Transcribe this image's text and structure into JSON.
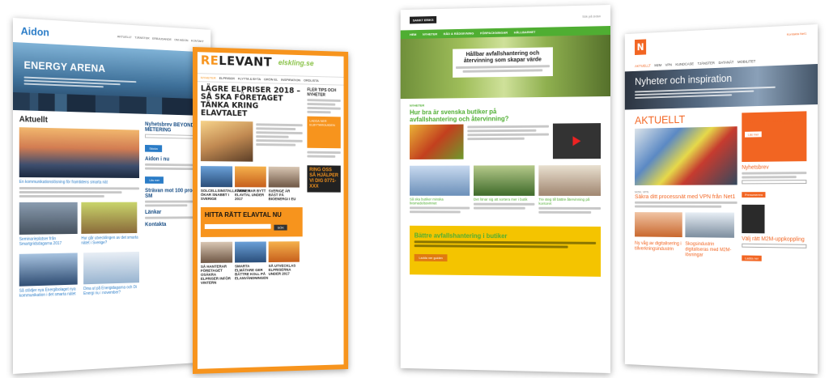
{
  "aidon": {
    "logo": "Aidon",
    "nav": [
      "AKTUELLT",
      "TJÄNSTER",
      "ERBJUDANDE",
      "OM AIDON",
      "KONTAKT"
    ],
    "hero_title": "ENERGY ARENA",
    "section_title": "Aktuellt",
    "article_link": "En kommunikationslösning för framtidens smarta nät",
    "thumb_links": [
      "Seminarieplatser från Smartgridsdagarna 2017",
      "Hur går utvecklingen av det smarta nätet i Sverige?",
      "Så stödjer nya Energibolaget nya kommunikation i det smarta nätet",
      "Dina ut på Energidagarna och Di Energi nu i november?"
    ],
    "sidebar_headings": [
      "Nyhetsbrev BEYOND METERING",
      "Aidon i nu",
      "Strävan mot 100 procent SM",
      "Länkar",
      "Kontakta"
    ],
    "sidebar_button": "Skicka",
    "sidebar_button2": "Läs mer"
  },
  "relevant": {
    "logo_re": "RE",
    "logo_rest": "LEVANT",
    "ad_label": "elskling.se",
    "nav": [
      "NYHETER",
      "ELPRISER",
      "FLYTTA & BYTA",
      "GRÖN EL",
      "INSPIRATION",
      "ORDLISTA"
    ],
    "headline": "LÄGRE ELPRISER 2018 – SÅ SKA FÖRETAGET TÄNKA KRING ELAVTALET",
    "grid_headlines": [
      "SOLCELLSINSTALLATIONER ÖKAR SNABBT I SVERIGE",
      "FÄRRE HAR BYTT ELAVTAL UNDER 2017",
      "SVERIGE ÄR BÄST PÅ BIOENERGI I EU"
    ],
    "cta_title": "HITTA RÄTT ELAVTAL NU",
    "cta_button": "SÖK",
    "side_title": "FLER TIPS OCH NYHETER",
    "side_box": "LADDA NER ELBYTARGUIDEN",
    "ring_box": "RING OSS SÅ HJÄLPER VI DIG 0771-XXX",
    "bottom_headlines": [
      "SÅ HANTERAR FÖRETAGET OSÄKRA ELPRISER INFÖR VINTERN",
      "SMARTA ELMÄTARE GER BÄTTRE KOLL PÅ ELANVÄNDNINGEN",
      "SÅ UTVECKLAS ELPRISERNA UNDER 2017"
    ]
  },
  "avfall": {
    "logo": "SANKT ERIKS",
    "search": "Sök på sidan",
    "nav": [
      "HEM",
      "NYHETER",
      "RÅD & RÅDGIVNING",
      "FÖRPACKNINGAR",
      "HÅLLBARHET"
    ],
    "hero_title": "Hållbar avfallshantering och återvinning som skapar värde",
    "kicker": "NYHETER",
    "main_heading": "Hur bra är svenska butiker på avfallshantering och återvinning?",
    "col_headings": [
      "Så ska butiker minska livsmedelssvinnet",
      "Det lönar sig att sortera mer i butik",
      "Tre steg till bättre återvinning på kontoret"
    ],
    "yellow_title": "Bättre avfallshantering i butiker",
    "yellow_button": "Ladda ner guiden"
  },
  "net1": {
    "logo": "N",
    "top_right": "Kontakta Net1",
    "nav": [
      "AKTUELLT",
      "M2M",
      "VPN",
      "KUNDCASE",
      "TJÄNSTER",
      "DATANÄT",
      "MOBILITET"
    ],
    "hero_title": "Nyheter och inspiration",
    "section_title": "AKTUELLT",
    "box_title": "Net1 – En stark partner",
    "box_button": "Läs mer",
    "kicker": "M2M, VPN",
    "article_title": "Säkra ditt processnät med VPN från Net1",
    "side_headings": [
      "Nyhetsbrev",
      "Välj rätt M2M-uppkoppling"
    ],
    "side_button": "Prenumerera",
    "side_button2": "Ladda ner",
    "bottom_titles": [
      "Ny våg av digitalisering i tillverkningsindustrin",
      "Skogsindustrin digitaliseras med M2M-lösningar"
    ]
  },
  "colors": {
    "aidon_blue": "#2a7cc7",
    "relevant_orange": "#f7941d",
    "avfall_green": "#4fae32",
    "avfall_yellow": "#f4c400",
    "net1_orange": "#f26522"
  }
}
